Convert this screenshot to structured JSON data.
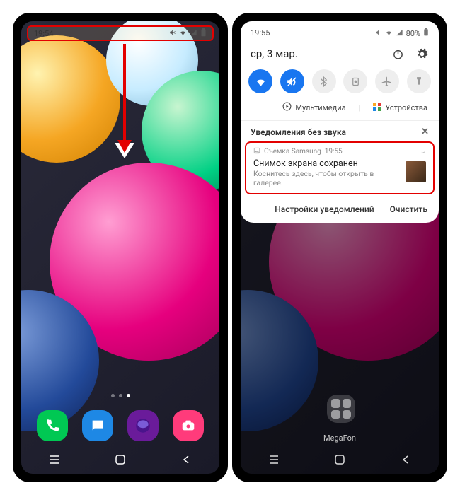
{
  "left": {
    "status": {
      "time": "19:54"
    },
    "dots": 3,
    "active_dot": 2,
    "dock": [
      {
        "name": "phone",
        "icon": "phone-icon"
      },
      {
        "name": "messages",
        "icon": "chat-icon"
      },
      {
        "name": "browser",
        "icon": "globe-icon"
      },
      {
        "name": "camera",
        "icon": "camera-icon"
      }
    ]
  },
  "right": {
    "status": {
      "time": "19:55",
      "battery": "80%"
    },
    "date": "ср, 3 мар.",
    "quick_settings": [
      {
        "name": "wifi",
        "on": true
      },
      {
        "name": "sound-mute",
        "on": true
      },
      {
        "name": "bluetooth",
        "on": false
      },
      {
        "name": "screen-record",
        "on": false
      },
      {
        "name": "airplane",
        "on": false
      },
      {
        "name": "flashlight",
        "on": false
      }
    ],
    "media_label": "Мультимедиа",
    "devices_label": "Устройства",
    "section_title": "Уведомления без звука",
    "notification": {
      "app": "Съемка Samsung",
      "time": "19:55",
      "title": "Снимок экрана сохранен",
      "body": "Коснитесь здесь, чтобы открыть в галерее."
    },
    "footer": {
      "settings": "Настройки уведомлений",
      "clear": "Очистить"
    },
    "carrier": "MegaFon"
  }
}
